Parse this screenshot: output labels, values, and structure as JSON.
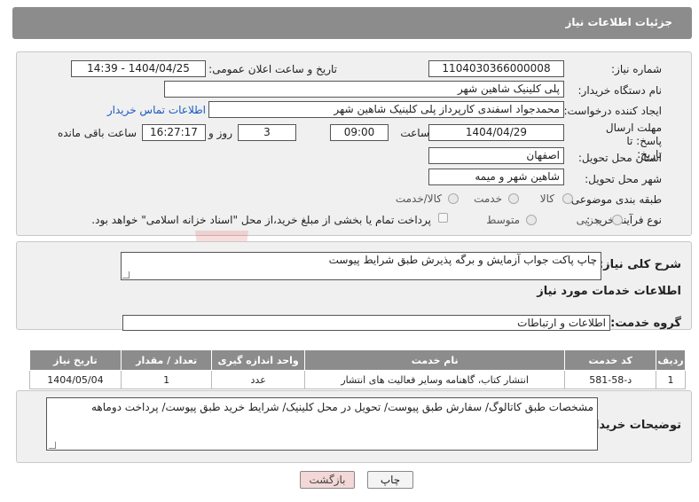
{
  "header": {
    "title": "جزئیات اطلاعات نیاز"
  },
  "fields": {
    "need_number_label": "شماره نیاز:",
    "need_number": "1104030366000008",
    "announce_label": "تاریخ و ساعت اعلان عمومی:",
    "announce_value": "1404/04/25 - 14:39",
    "buyer_org_label": "نام دستگاه خریدار:",
    "buyer_org": "پلی کلینیک شاهین شهر",
    "creator_label": "ایجاد کننده درخواست:",
    "creator": "محمدجواد اسفندی کارپرداز پلی کلینیک شاهین شهر",
    "contact_link": "اطلاعات تماس خریدار",
    "deadline_label": "مهلت ارسال پاسخ: تا تاریخ:",
    "deadline_date": "1404/04/29",
    "time_label": "ساعت",
    "deadline_time": "09:00",
    "days_value": "3",
    "days_label": "روز و",
    "remaining_time": "16:27:17",
    "remaining_label": "ساعت باقی مانده",
    "province_label": "استان محل تحویل:",
    "province": "اصفهان",
    "city_label": "شهر محل تحویل:",
    "city": "شاهین شهر و میمه",
    "category_label": "طبقه بندی موضوعی:",
    "category_options": [
      "کالا",
      "خدمت",
      "کالا/خدمت"
    ],
    "process_label": "نوع فرآیند خرید :",
    "process_options": [
      "جزیی",
      "متوسط"
    ],
    "payment_note": "پرداخت تمام یا بخشی از مبلغ خرید،از محل \"اسناد خزانه اسلامی\" خواهد بود."
  },
  "summary": {
    "label": "شرح کلی نیاز:",
    "text": "چاپ پاکت جواب آزمایش و برگه پذیرش طبق شرایط پیوست"
  },
  "services": {
    "section_title": "اطلاعات خدمات مورد نیاز",
    "group_label": "گروه خدمت:",
    "group_value": "اطلاعات و ارتباطات",
    "columns": [
      "ردیف",
      "کد خدمت",
      "نام خدمت",
      "واحد اندازه گیری",
      "تعداد / مقدار",
      "تاریخ نیاز"
    ],
    "rows": [
      [
        "1",
        "د-58-581",
        "انتشار کتاب، گاهنامه وسایر فعالیت های انتشار",
        "عدد",
        "1",
        "1404/05/04"
      ]
    ]
  },
  "buyer_notes": {
    "label": "توضیحات خریدار:",
    "text": "مشخصات طبق کاتالوگ/ سفارش طبق پیوست/ تحویل در محل کلینیک/ شرایط خرید طبق پیوست/ پرداخت دوماهه"
  },
  "buttons": {
    "print": "چاپ",
    "back": "بازگشت"
  },
  "watermark": "AriaTender.net",
  "colors": {
    "header": "#8c8c8c",
    "panel": "#f0f0f0",
    "link": "#1a5bbf",
    "back_button": "#f4d7d7",
    "watermark": "#d33"
  }
}
